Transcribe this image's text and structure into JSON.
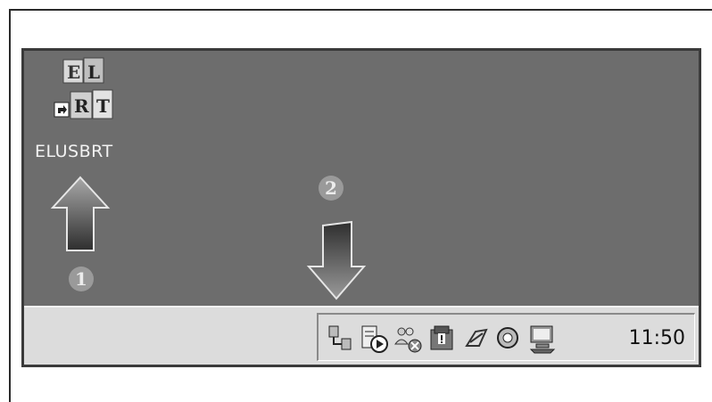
{
  "desktop": {
    "icon": {
      "label": "ELUSBRT",
      "graphic_name": "elusbrt-blocks-icon"
    },
    "arrows": [
      {
        "direction": "up",
        "badge": "1"
      },
      {
        "direction": "down",
        "badge": "2"
      }
    ]
  },
  "taskbar": {
    "tray_icons": [
      "network-icon",
      "media-player-icon",
      "users-disconnected-icon",
      "warning-security-icon",
      "link-icon",
      "volume-icon",
      "computer-monitor-icon"
    ],
    "clock": "11:50"
  },
  "colors": {
    "desktop_bg": "#6d6d6d",
    "taskbar_bg": "#dcdcdc",
    "arrow_gradient_top": "#9a9a9a",
    "arrow_gradient_bottom": "#2e2e2e"
  }
}
